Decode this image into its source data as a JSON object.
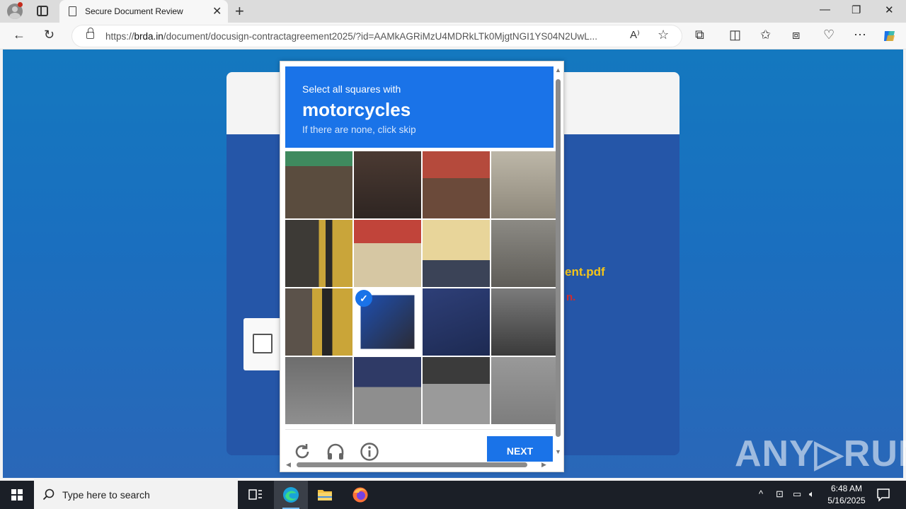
{
  "browser": {
    "tab_title": "Secure Document Review",
    "tab_close": "✕",
    "new_tab": "+",
    "url_prefix": "https://",
    "url_host": "brda.in",
    "url_rest": "/document/docusign-contractagreement2025/?id=AAMkAGRiMzU4MDRkLTk0MjgtNGI1YS04N2UwL...",
    "window_controls": [
      "—",
      "❐",
      "✕"
    ]
  },
  "page": {
    "document_name": "ent.pdf",
    "red_text": "n."
  },
  "challenge": {
    "line1": "Select all squares with",
    "target": "motorcycles",
    "line3": "If there are none, click skip",
    "next_label": "NEXT",
    "grid": {
      "rows": 4,
      "cols": 4,
      "selected": [
        [
          2,
          1
        ]
      ]
    }
  },
  "taskbar": {
    "search_placeholder": "Type here to search",
    "time": "6:48 AM",
    "date": "5/16/2025"
  },
  "watermark": "ANY▷RUN",
  "colors": {
    "accent": "#1a73e8",
    "doc_name": "#f5c518",
    "red_text": "#d62b2b"
  }
}
